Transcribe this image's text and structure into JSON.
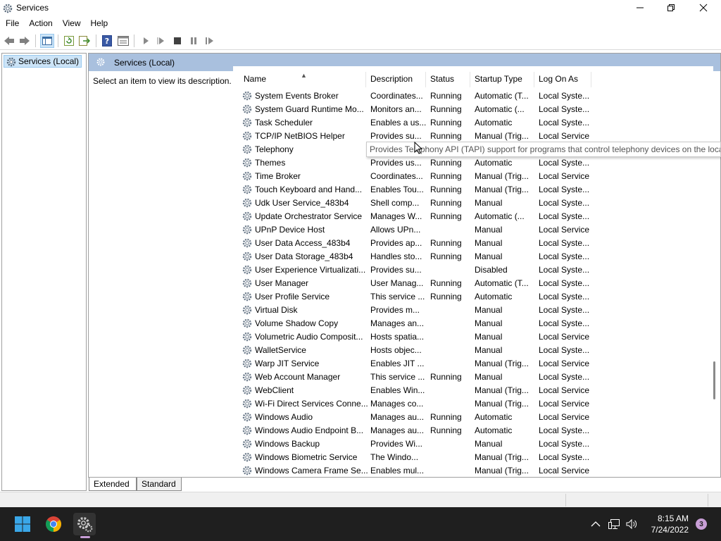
{
  "window": {
    "title": "Services",
    "controls": {
      "minimize": "minimize",
      "maximize": "restore",
      "close": "close"
    }
  },
  "menu": [
    "File",
    "Action",
    "View",
    "Help"
  ],
  "toolbar_icons": [
    "back-arrow-icon",
    "forward-arrow-icon",
    "show-hide-tree-icon",
    "refresh-icon",
    "export-list-icon",
    "help-icon",
    "properties-icon",
    "start-service-icon",
    "start-service-alt-icon",
    "stop-service-icon",
    "pause-service-icon",
    "restart-service-icon"
  ],
  "tree": {
    "root_label": "Services (Local)"
  },
  "right_pane": {
    "header_title": "Services (Local)",
    "description_prompt": "Select an item to view its description."
  },
  "columns": {
    "name": "Name",
    "description": "Description",
    "status": "Status",
    "startup_type": "Startup Type",
    "log_on_as": "Log On As"
  },
  "services": [
    {
      "name": "System Events Broker",
      "description": "Coordinates...",
      "status": "Running",
      "startup": "Automatic (T...",
      "logon": "Local Syste..."
    },
    {
      "name": "System Guard Runtime Mo...",
      "description": "Monitors an...",
      "status": "Running",
      "startup": "Automatic (...",
      "logon": "Local Syste..."
    },
    {
      "name": "Task Scheduler",
      "description": "Enables a us...",
      "status": "Running",
      "startup": "Automatic",
      "logon": "Local Syste..."
    },
    {
      "name": "TCP/IP NetBIOS Helper",
      "description": "Provides su...",
      "status": "Running",
      "startup": "Manual (Trig...",
      "logon": "Local Service"
    },
    {
      "name": "Telephony",
      "description": "",
      "status": "",
      "startup": "",
      "logon": ""
    },
    {
      "name": "Themes",
      "description": "Provides us...",
      "status": "Running",
      "startup": "Automatic",
      "logon": "Local Syste..."
    },
    {
      "name": "Time Broker",
      "description": "Coordinates...",
      "status": "Running",
      "startup": "Manual (Trig...",
      "logon": "Local Service"
    },
    {
      "name": "Touch Keyboard and Hand...",
      "description": "Enables Tou...",
      "status": "Running",
      "startup": "Manual (Trig...",
      "logon": "Local Syste..."
    },
    {
      "name": "Udk User Service_483b4",
      "description": "Shell comp...",
      "status": "Running",
      "startup": "Manual",
      "logon": "Local Syste..."
    },
    {
      "name": "Update Orchestrator Service",
      "description": "Manages W...",
      "status": "Running",
      "startup": "Automatic (...",
      "logon": "Local Syste..."
    },
    {
      "name": "UPnP Device Host",
      "description": "Allows UPn...",
      "status": "",
      "startup": "Manual",
      "logon": "Local Service"
    },
    {
      "name": "User Data Access_483b4",
      "description": "Provides ap...",
      "status": "Running",
      "startup": "Manual",
      "logon": "Local Syste..."
    },
    {
      "name": "User Data Storage_483b4",
      "description": "Handles sto...",
      "status": "Running",
      "startup": "Manual",
      "logon": "Local Syste..."
    },
    {
      "name": "User Experience Virtualizati...",
      "description": "Provides su...",
      "status": "",
      "startup": "Disabled",
      "logon": "Local Syste..."
    },
    {
      "name": "User Manager",
      "description": "User Manag...",
      "status": "Running",
      "startup": "Automatic (T...",
      "logon": "Local Syste..."
    },
    {
      "name": "User Profile Service",
      "description": "This service ...",
      "status": "Running",
      "startup": "Automatic",
      "logon": "Local Syste..."
    },
    {
      "name": "Virtual Disk",
      "description": "Provides m...",
      "status": "",
      "startup": "Manual",
      "logon": "Local Syste..."
    },
    {
      "name": "Volume Shadow Copy",
      "description": "Manages an...",
      "status": "",
      "startup": "Manual",
      "logon": "Local Syste..."
    },
    {
      "name": "Volumetric Audio Composit...",
      "description": "Hosts spatia...",
      "status": "",
      "startup": "Manual",
      "logon": "Local Service"
    },
    {
      "name": "WalletService",
      "description": "Hosts objec...",
      "status": "",
      "startup": "Manual",
      "logon": "Local Syste..."
    },
    {
      "name": "Warp JIT Service",
      "description": "Enables JIT ...",
      "status": "",
      "startup": "Manual (Trig...",
      "logon": "Local Service"
    },
    {
      "name": "Web Account Manager",
      "description": "This service ...",
      "status": "Running",
      "startup": "Manual",
      "logon": "Local Syste..."
    },
    {
      "name": "WebClient",
      "description": "Enables Win...",
      "status": "",
      "startup": "Manual (Trig...",
      "logon": "Local Service"
    },
    {
      "name": "Wi-Fi Direct Services Conne...",
      "description": "Manages co...",
      "status": "",
      "startup": "Manual (Trig...",
      "logon": "Local Service"
    },
    {
      "name": "Windows Audio",
      "description": "Manages au...",
      "status": "Running",
      "startup": "Automatic",
      "logon": "Local Service"
    },
    {
      "name": "Windows Audio Endpoint B...",
      "description": "Manages au...",
      "status": "Running",
      "startup": "Automatic",
      "logon": "Local Syste..."
    },
    {
      "name": "Windows Backup",
      "description": "Provides Wi...",
      "status": "",
      "startup": "Manual",
      "logon": "Local Syste..."
    },
    {
      "name": "Windows Biometric Service",
      "description": "The Windo...",
      "status": "",
      "startup": "Manual (Trig...",
      "logon": "Local Syste..."
    },
    {
      "name": "Windows Camera Frame Se...",
      "description": "Enables mul...",
      "status": "",
      "startup": "Manual (Trig...",
      "logon": "Local Service"
    }
  ],
  "tooltip": "Provides Telephony API (TAPI) support for programs that control telephony devices on the loca",
  "tabs": [
    "Extended",
    "Standard"
  ],
  "taskbar": {
    "apps": [
      "windows-start-icon",
      "chrome-icon",
      "services-app-icon"
    ],
    "tray_icons": [
      "chevron-up-icon",
      "network-icon",
      "volume-icon"
    ],
    "time": "8:15 AM",
    "date": "7/24/2022",
    "notification_count": "3"
  },
  "colors": {
    "header_band": "#a9c0de",
    "tree_selection": "#cce4f7",
    "taskbar_bg": "#1f1f1f",
    "accent": "#c89ed6"
  }
}
